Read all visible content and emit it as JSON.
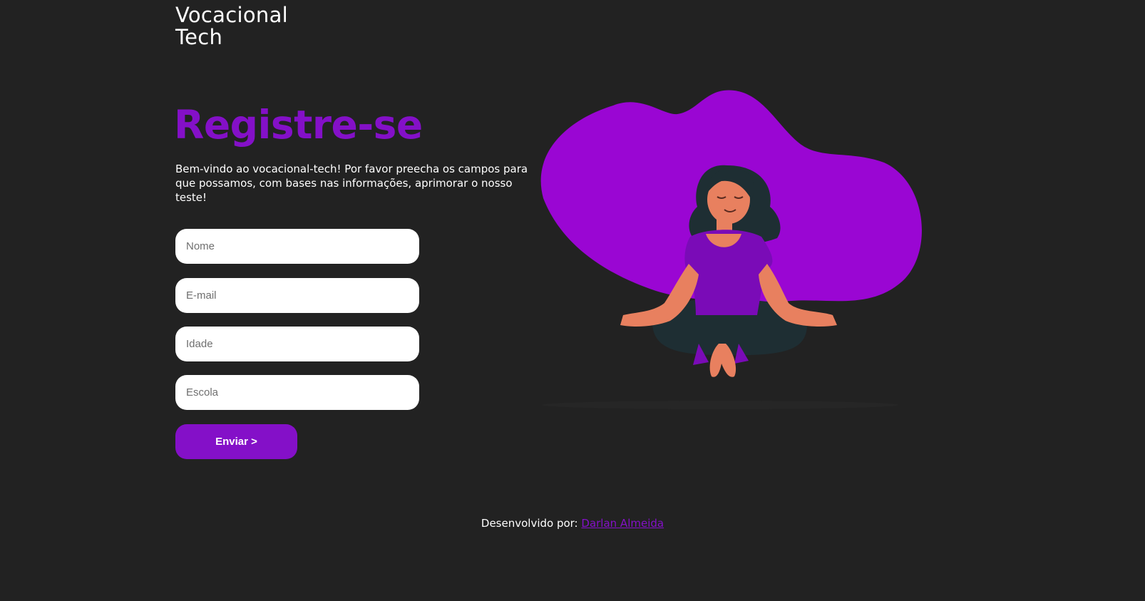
{
  "brand": {
    "line1": "Vocacional",
    "line2": "Tech"
  },
  "hero": {
    "title": "Registre-se",
    "intro": "Bem-vindo ao vocacional-tech! Por favor preecha os campos para que possamos, com bases nas informações, aprimorar o nosso teste!"
  },
  "form": {
    "fields": [
      {
        "placeholder": "Nome",
        "value": ""
      },
      {
        "placeholder": "E-mail",
        "value": ""
      },
      {
        "placeholder": "Idade",
        "value": ""
      },
      {
        "placeholder": "Escola",
        "value": ""
      }
    ],
    "submit_label": "Enviar >"
  },
  "footer": {
    "prefix": "Desenvolvido por:",
    "author": "Darlan Almeida"
  },
  "colors": {
    "background": "#222222",
    "accent": "#8410c8",
    "blob": "#9a06d3",
    "hair_pants": "#1e2e33",
    "skin": "#e8805f",
    "shirt": "#7a0bb7"
  },
  "icons": {
    "illustration": "meditating-woman-illustration"
  }
}
